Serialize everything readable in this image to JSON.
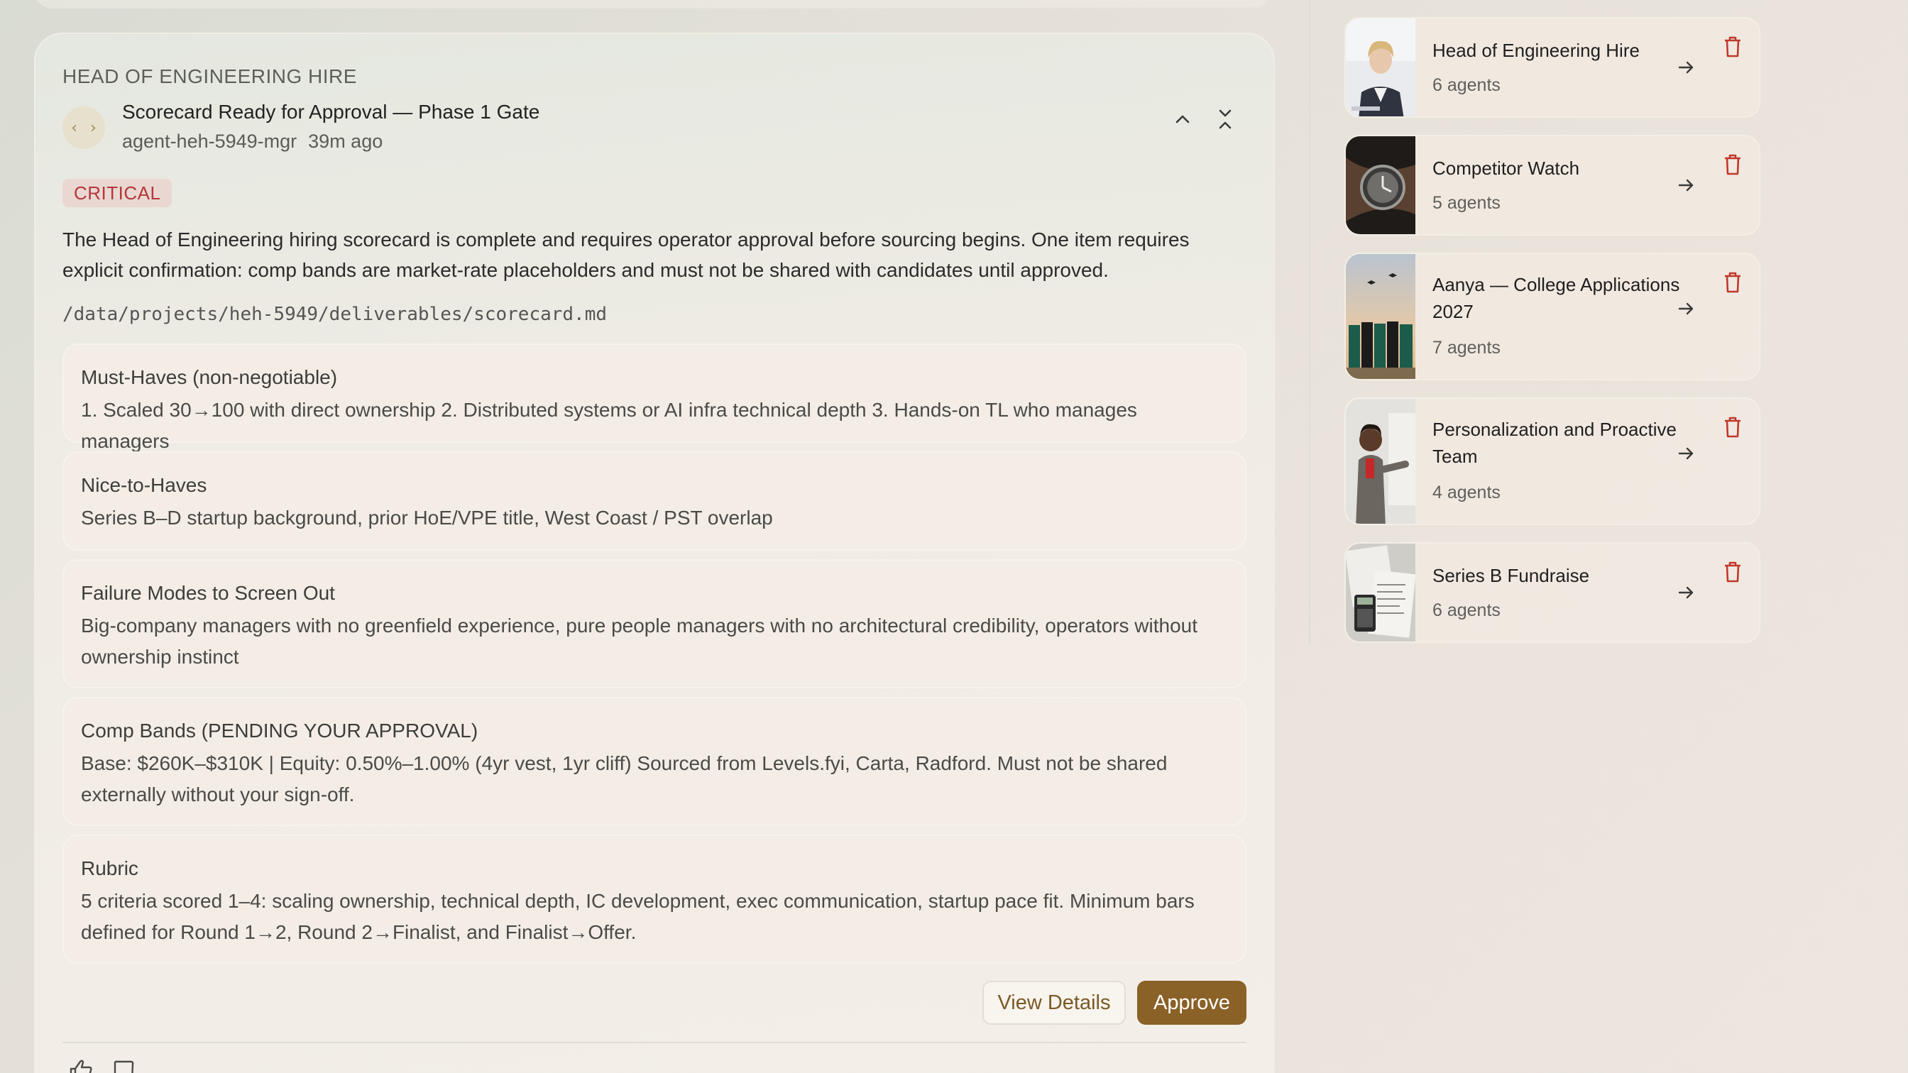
{
  "message": {
    "project_label": "HEAD OF ENGINEERING HIRE",
    "title": "Scorecard Ready for Approval — Phase 1 Gate",
    "agent": "agent-heh-5949-mgr",
    "time_ago": "39m ago",
    "avatar_glyph": "‹ ›",
    "priority": "CRITICAL",
    "summary": "The Head of Engineering hiring scorecard is complete and requires operator approval before sourcing begins. One item requires explicit confirmation: comp bands are market-rate placeholders and must not be shared with candidates until approved.",
    "file_path": "/data/projects/heh-5949/deliverables/scorecard.md",
    "sections": [
      {
        "title": "Must-Haves (non-negotiable)",
        "body": "1. Scaled 30→100 with direct ownership 2. Distributed systems or AI infra technical depth 3. Hands-on TL who manages managers"
      },
      {
        "title": "Nice-to-Haves",
        "body": "Series B–D startup background, prior HoE/VPE title, West Coast / PST overlap"
      },
      {
        "title": "Failure Modes to Screen Out",
        "body": "Big-company managers with no greenfield experience, pure people managers with no architectural credibility, operators without ownership instinct"
      },
      {
        "title": "Comp Bands (PENDING YOUR APPROVAL)",
        "body": "Base: $260K–$310K | Equity: 0.50%–1.00% (4yr vest, 1yr cliff) Sourced from Levels.fyi, Carta, Radford. Must not be shared externally without your sign-off."
      },
      {
        "title": "Rubric",
        "body": "5 criteria scored 1–4: scaling ownership, technical depth, IC development, exec communication, startup pace fit. Minimum bars defined for Round 1→2, Round 2→Finalist, and Finalist→Offer."
      }
    ],
    "buttons": {
      "details": "View Details",
      "approve": "Approve"
    }
  },
  "colors": {
    "accent": "#8a6126",
    "critical_text": "#b4383a",
    "critical_bg": "#ead7d2",
    "trash": "#c0392b"
  },
  "projects": [
    {
      "name": "Head of Engineering Hire",
      "agents": "6 agents",
      "thumb_icon": "person-portrait-thumbnail"
    },
    {
      "name": "Competitor Watch",
      "agents": "5 agents",
      "thumb_icon": "wristwatch-thumbnail"
    },
    {
      "name": "Aanya — College Applications 2027",
      "agents": "7 agents",
      "thumb_icon": "graduates-thumbnail"
    },
    {
      "name": "Personalization and Proactive Team",
      "agents": "4 agents",
      "thumb_icon": "presenter-thumbnail"
    },
    {
      "name": "Series B Fundraise",
      "agents": "6 agents",
      "thumb_icon": "calculator-documents-thumbnail"
    }
  ]
}
